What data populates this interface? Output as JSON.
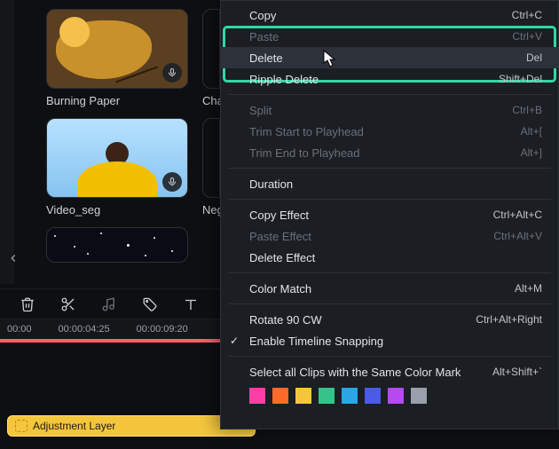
{
  "media": {
    "row1": [
      {
        "label": "Burning Paper",
        "thumb_class": "t-burning-paper",
        "has_mic": true
      },
      {
        "label": "Cha",
        "thumb_class": "",
        "has_mic": false
      }
    ],
    "row2": [
      {
        "label": "Video_seg",
        "thumb_class": "t-video-seg",
        "has_mic": true
      },
      {
        "label": "Neg",
        "thumb_class": "",
        "has_mic": false
      }
    ]
  },
  "timeline": {
    "timecodes": [
      "00:00",
      "00:00:04:25",
      "00:00:09:20"
    ],
    "adjustment_clip_label": "Adjustment Layer"
  },
  "context_menu": {
    "items": [
      {
        "kind": "item",
        "label": "Copy",
        "shortcut": "Ctrl+C",
        "state": "enabled"
      },
      {
        "kind": "item",
        "label": "Paste",
        "shortcut": "Ctrl+V",
        "state": "disabled"
      },
      {
        "kind": "item",
        "label": "Delete",
        "shortcut": "Del",
        "state": "hover"
      },
      {
        "kind": "item",
        "label": "Ripple Delete",
        "shortcut": "Shift+Del",
        "state": "enabled"
      },
      {
        "kind": "sep"
      },
      {
        "kind": "item",
        "label": "Split",
        "shortcut": "Ctrl+B",
        "state": "disabled"
      },
      {
        "kind": "item",
        "label": "Trim Start to Playhead",
        "shortcut": "Alt+[",
        "state": "disabled"
      },
      {
        "kind": "item",
        "label": "Trim End to Playhead",
        "shortcut": "Alt+]",
        "state": "disabled"
      },
      {
        "kind": "sep"
      },
      {
        "kind": "item",
        "label": "Duration",
        "shortcut": "",
        "state": "enabled"
      },
      {
        "kind": "sep"
      },
      {
        "kind": "item",
        "label": "Copy Effect",
        "shortcut": "Ctrl+Alt+C",
        "state": "enabled"
      },
      {
        "kind": "item",
        "label": "Paste Effect",
        "shortcut": "Ctrl+Alt+V",
        "state": "disabled"
      },
      {
        "kind": "item",
        "label": "Delete Effect",
        "shortcut": "",
        "state": "enabled"
      },
      {
        "kind": "sep"
      },
      {
        "kind": "item",
        "label": "Color Match",
        "shortcut": "Alt+M",
        "state": "enabled"
      },
      {
        "kind": "sep"
      },
      {
        "kind": "item",
        "label": "Rotate 90 CW",
        "shortcut": "Ctrl+Alt+Right",
        "state": "enabled"
      },
      {
        "kind": "check",
        "label": "Enable Timeline Snapping",
        "shortcut": "",
        "state": "enabled",
        "checked": true
      },
      {
        "kind": "sep"
      },
      {
        "kind": "item",
        "label": "Select all Clips with the Same Color Mark",
        "shortcut": "Alt+Shift+`",
        "state": "enabled"
      }
    ],
    "colors": [
      "#ff3ea5",
      "#ff6a2b",
      "#f4c63d",
      "#33c48a",
      "#2aa6e6",
      "#4a5be6",
      "#b44af0",
      "#9aa0ab"
    ]
  }
}
